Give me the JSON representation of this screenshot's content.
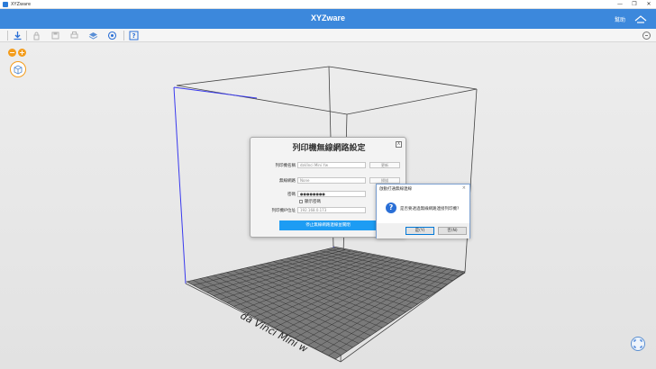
{
  "window": {
    "title": "XYZware",
    "controls": [
      "—",
      "❐",
      "✕"
    ]
  },
  "header": {
    "app_name": "XYZware",
    "help_label": "幫助"
  },
  "toolbar": {
    "buttons": [
      "import-icon",
      "lock-icon",
      "save-icon",
      "print-icon",
      "layers-icon",
      "wifi-settings-icon",
      "help-icon"
    ]
  },
  "viewport": {
    "zoom_out": "−",
    "zoom_in": "+",
    "platform_label": "da Vinci Mini w"
  },
  "wifi_dialog": {
    "title": "列印機無線網路設定",
    "close": "X",
    "fields": {
      "printer_name_label": "列印機名稱",
      "printer_name_value": "daVinci Mini Yw",
      "rename_button": "更新",
      "network_label": "無線網路",
      "network_value": "None",
      "scan_button": "掃描",
      "password_label": "密碼",
      "password_value": "●●●●●●●●",
      "show_password_label": "顯示密碼",
      "ip_label": "列印機IP位址",
      "ip_value": "192.168.0.173"
    },
    "submit_button": "停止無線網路連線並關閉"
  },
  "confirm_box": {
    "title": "啟動打通無線連線",
    "close": "×",
    "message": "是否要透過無線網路連接列印機?",
    "yes_button": "是(Y)",
    "no_button": "否(N)"
  },
  "colors": {
    "header_blue": "#3c88dc",
    "primary_button": "#1d9cf3",
    "accent_orange": "#f39c1c",
    "axis_blue": "#3a3aee"
  }
}
